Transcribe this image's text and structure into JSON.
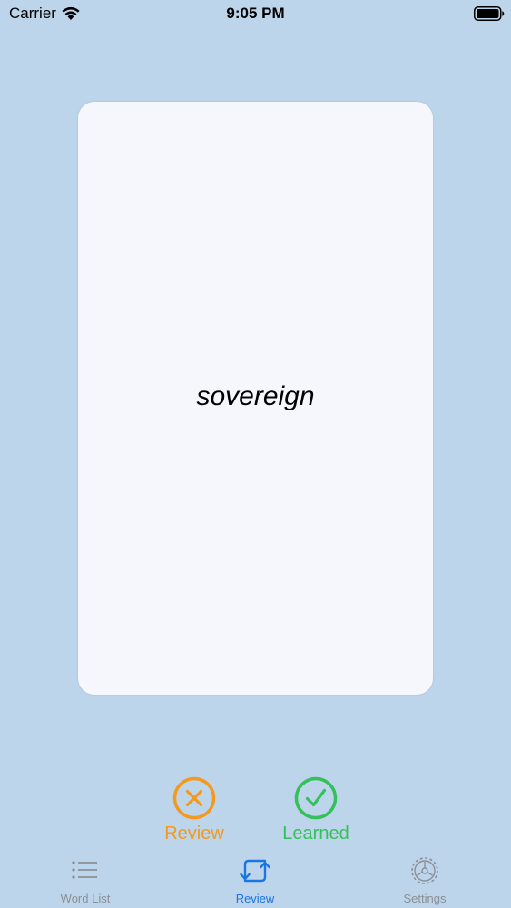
{
  "status_bar": {
    "carrier": "Carrier",
    "time": "9:05 PM",
    "icons": [
      "wifi-icon",
      "battery-icon"
    ]
  },
  "card": {
    "word": "sovereign"
  },
  "actions": {
    "review": {
      "label": "Review",
      "icon": "x-circle-icon",
      "color": "#f39a1e"
    },
    "learned": {
      "label": "Learned",
      "icon": "check-circle-icon",
      "color": "#34c05a"
    }
  },
  "tab_bar": {
    "active": "Review",
    "tabs": [
      {
        "label": "Word List",
        "icon": "list-icon"
      },
      {
        "label": "Review",
        "icon": "repeat-icon"
      },
      {
        "label": "Settings",
        "icon": "gear-icon"
      }
    ],
    "active_color": "#1976e3",
    "inactive_color": "#8a8f96"
  },
  "colors": {
    "background": "#bdd5ea",
    "card": "#f5f7fd"
  }
}
